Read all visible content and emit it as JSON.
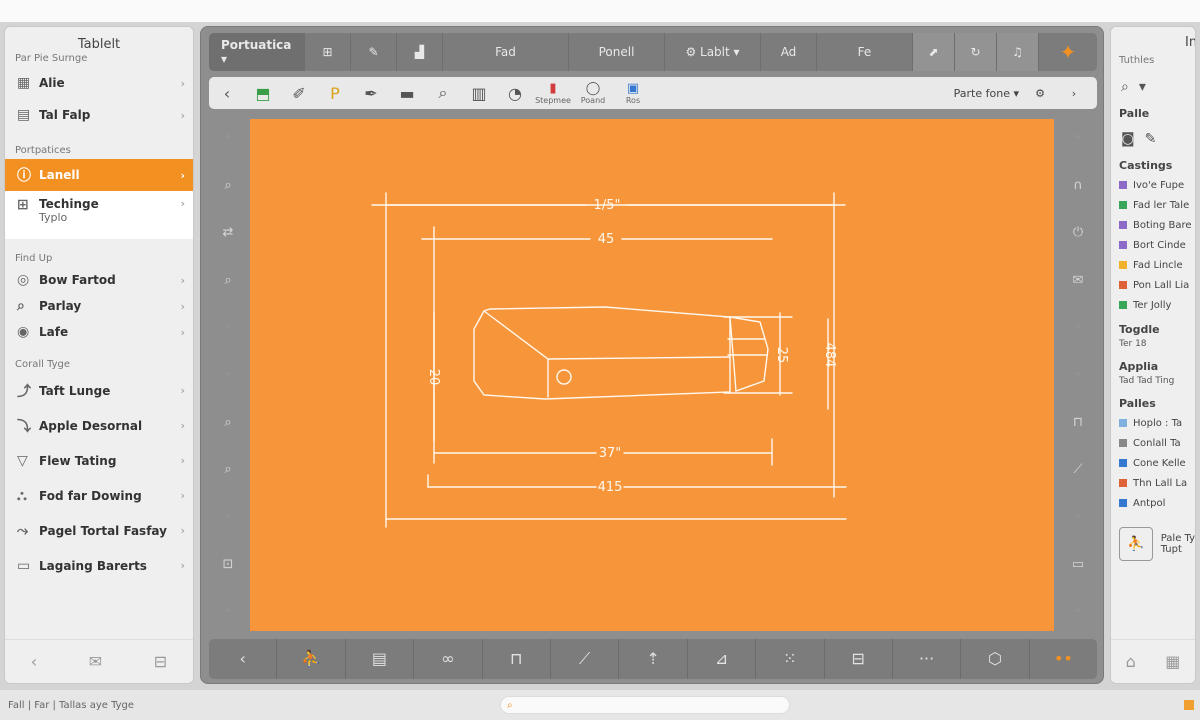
{
  "left_panel": {
    "title": "Tablelt",
    "subtitle": "Par Pie Surnge",
    "top_items": [
      {
        "icon": "▦",
        "label": "Alie"
      },
      {
        "icon": "▤",
        "label": "Tal Falp"
      }
    ],
    "section1": "Portpatices",
    "active_item": {
      "icon": "ⓘ",
      "label": "Lanell"
    },
    "white_item": {
      "icon": "⊞",
      "label": "Techinge",
      "sub": "Typlo"
    },
    "section2": "Find Up",
    "mid_items": [
      {
        "icon": "◎",
        "label": "Bow Fartod"
      },
      {
        "icon": "⌕",
        "label": "Parlay"
      },
      {
        "icon": "◉",
        "label": "Lafe"
      }
    ],
    "section3": "Corall Tyge",
    "tool_items": [
      {
        "icon": "⤴",
        "label": "Taft Lunge"
      },
      {
        "icon": "⤵",
        "label": "Apple Desornal"
      },
      {
        "icon": "▽",
        "label": "Flew Tating"
      },
      {
        "icon": "⛬",
        "label": "Fod far Dowing"
      },
      {
        "icon": "⤳",
        "label": "Pagel Tortal Fasfay"
      },
      {
        "icon": "▭",
        "label": "Lagaing Barerts"
      }
    ],
    "chevron": "›",
    "bottom_icons": [
      "‹",
      "✉",
      "⊟"
    ]
  },
  "top_toolbar": {
    "dropdown_label": "Portuatica ▾",
    "buttons": [
      {
        "label": "⊞"
      },
      {
        "label": "✎"
      },
      {
        "label": "▟"
      },
      {
        "label": "Fad"
      },
      {
        "label": "Ponell"
      },
      {
        "label": "⚙ Lablt ▾"
      },
      {
        "label": "Ad"
      },
      {
        "label": "Fe"
      },
      {
        "label": "⬈"
      },
      {
        "label": "↻"
      },
      {
        "label": "♫"
      },
      {
        "label": "✦"
      }
    ]
  },
  "tool_row": {
    "buttons": [
      "‹",
      "⬒",
      "✐",
      "P",
      "✒",
      "▬",
      "⌕",
      "▥",
      "◔"
    ],
    "labeled": [
      {
        "icon": "▮",
        "label": "Stepmee"
      },
      {
        "icon": "◯",
        "label": "Poand"
      },
      {
        "icon": "▣",
        "label": "Ros"
      }
    ],
    "right_label": "Parte fone ▾",
    "gear": "⚙",
    "next": "›"
  },
  "left_side_tools": [
    "◦",
    "⌕",
    "⇄",
    "⌕",
    "◦",
    "◦",
    "⌕",
    "⌕",
    "◦",
    "⊡",
    "◦"
  ],
  "right_side_tools": [
    "◦",
    "∩",
    "⏻",
    "✉",
    "◦",
    "◦",
    "⊓",
    "⟋",
    "◦",
    "▭",
    "◦"
  ],
  "drawing": {
    "dim_outer_width": "1/5\"",
    "dim_inner_width": "45",
    "dim_left_height": "20",
    "dim_right_inner": "25",
    "dim_right_outer": "484",
    "dim_bottom_inner": "37\"",
    "dim_bottom_outer": "415"
  },
  "bottom_toolbar": [
    "‹",
    "⛹",
    "▤",
    "∞",
    "⊓",
    "⟋",
    "⇡",
    "⊿",
    "⁙",
    "⊟",
    "···",
    "⬡",
    "••"
  ],
  "right_panel": {
    "head": "Ine",
    "label1": "Tuthles",
    "heading1": "Palle",
    "heading2": "Castings",
    "layers": [
      {
        "color": "#8e6ac8",
        "label": "Ivo'e Fupe"
      },
      {
        "color": "#3aa65a",
        "label": "Fad ler Tale"
      },
      {
        "color": "#8e6ac8",
        "label": "Boting Bare"
      },
      {
        "color": "#8e6ac8",
        "label": "Bort Cinde"
      },
      {
        "color": "#f2b12a",
        "label": "Fad Lincle"
      },
      {
        "color": "#e0623a",
        "label": "Pon Lall Lia"
      },
      {
        "color": "#3aa65a",
        "label": "Ter Jolly"
      }
    ],
    "heading3": "Togdle",
    "small3": "Ter 18",
    "heading4": "Applia",
    "small4": "Tad Tad Ting",
    "heading5": "Palles",
    "layers2": [
      {
        "color": "#7fb0e0",
        "label": "Hoplo : Ta"
      },
      {
        "color": "#888888",
        "label": "Conlall Ta"
      },
      {
        "color": "#3478d1",
        "label": "Cone Kelle"
      },
      {
        "color": "#e0623a",
        "label": "Thn Lall La"
      },
      {
        "color": "#3478d1",
        "label": "Antpol"
      }
    ],
    "card_label": "Pale Ty",
    "card_sub": "Tupt",
    "bottom_icons": [
      "⌂",
      "▦"
    ]
  },
  "status_bar": {
    "text": "Fall | Far | Tallas aye Tyge",
    "field_icon": "⌕"
  }
}
